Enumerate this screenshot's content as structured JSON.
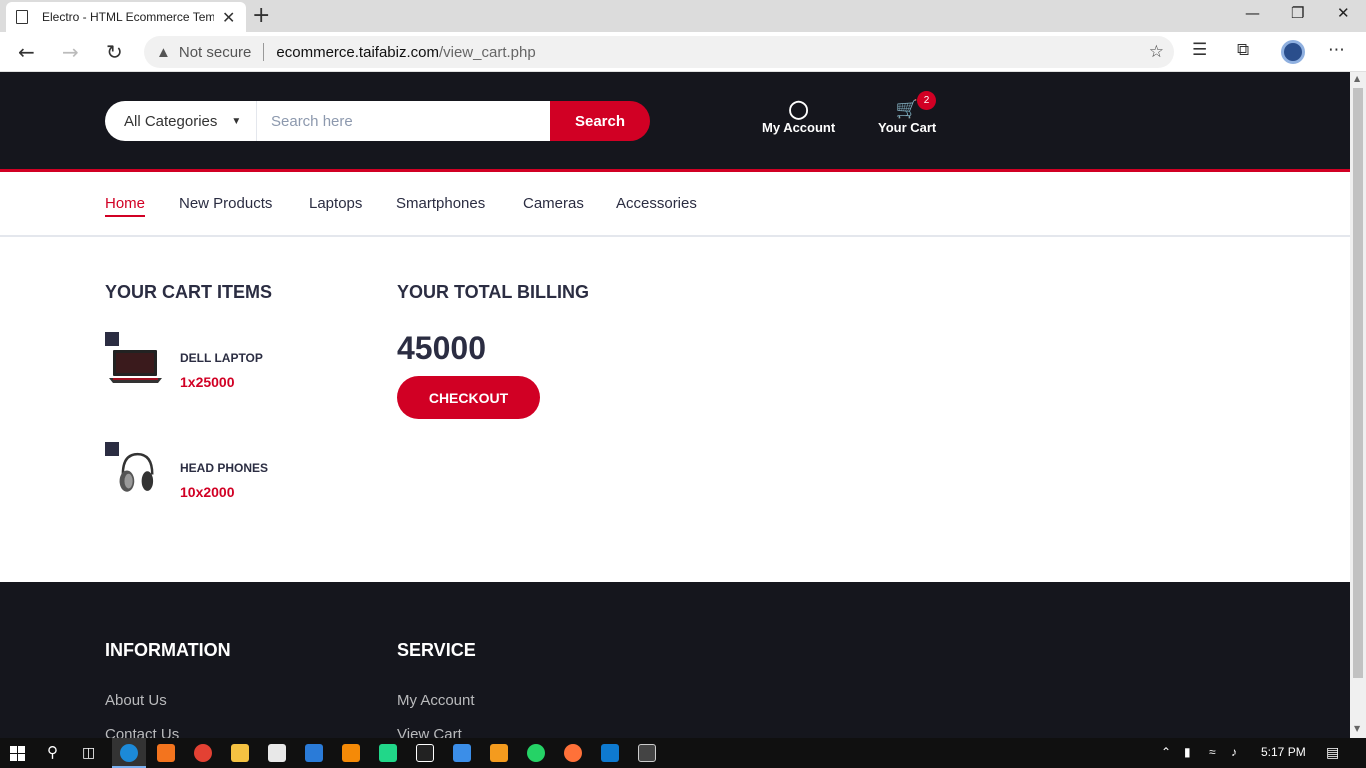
{
  "browser": {
    "tab_title": "Electro - HTML Ecommerce Template",
    "tab_close": "✕",
    "new_tab": "+",
    "security": "Not secure",
    "url_host": "ecommerce.taifabiz.com",
    "url_path": "/view_cart.php"
  },
  "header": {
    "category_selected": "All Categories",
    "search_placeholder": "Search here",
    "search_button": "Search",
    "account_label": "My Account",
    "cart_label": "Your Cart",
    "cart_count": "2"
  },
  "nav": {
    "items": [
      "Home",
      "New Products",
      "Laptops",
      "Smartphones",
      "Cameras",
      "Accessories"
    ],
    "active": "Home"
  },
  "cart": {
    "heading": "YOUR CART ITEMS",
    "items": [
      {
        "name": "DELL LAPTOP",
        "qty": "1x25000"
      },
      {
        "name": "HEAD PHONES",
        "qty": "10x2000"
      }
    ]
  },
  "billing": {
    "heading": "YOUR TOTAL BILLING",
    "total": "45000",
    "checkout": "CHECKOUT"
  },
  "footer": {
    "information": {
      "heading": "INFORMATION",
      "links": [
        "About Us",
        "Contact Us"
      ]
    },
    "service": {
      "heading": "SERVICE",
      "links": [
        "My Account",
        "View Cart"
      ]
    }
  },
  "taskbar": {
    "time": "5:17 PM"
  },
  "colors": {
    "accent": "#d10024",
    "dark": "#15161d",
    "text": "#2b2d42"
  }
}
